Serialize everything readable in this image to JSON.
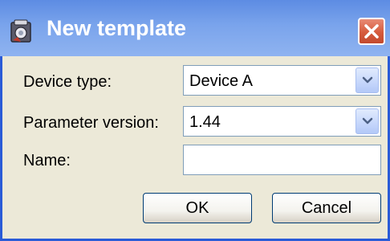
{
  "window": {
    "title": "New template",
    "title_icon": "app-icon",
    "close_icon": "close-icon"
  },
  "form": {
    "device_type": {
      "label": "Device type:",
      "value": "Device A"
    },
    "parameter_version": {
      "label": "Parameter version:",
      "value": "1.44"
    },
    "name": {
      "label": "Name:",
      "value": ""
    }
  },
  "buttons": {
    "ok": "OK",
    "cancel": "Cancel"
  },
  "colors": {
    "titlebar": "#7aa4ec",
    "window_border": "#2a5bd7",
    "dialog_bg": "#ece9d8",
    "close_button": "#d65a3c"
  }
}
